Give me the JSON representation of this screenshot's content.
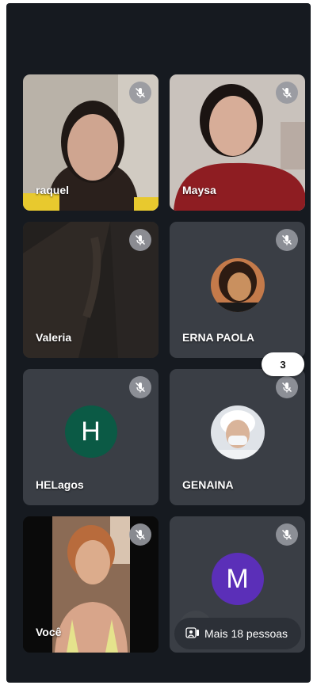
{
  "participants": [
    {
      "name": "raquel"
    },
    {
      "name": "Maysa"
    },
    {
      "name": "Valeria"
    },
    {
      "name": "ERNA PAOLA"
    },
    {
      "name": "HELagos",
      "initial": "H",
      "color": "#0b5a45"
    },
    {
      "name": "GENAINA"
    },
    {
      "name": "Você"
    },
    {
      "initial": "M",
      "color": "#5b2fb8"
    }
  ],
  "page_indicator": "3",
  "more_people": "Mais 18 pessoas",
  "icons": {
    "mic_off": "mic-off-icon",
    "people": "people-icon"
  }
}
